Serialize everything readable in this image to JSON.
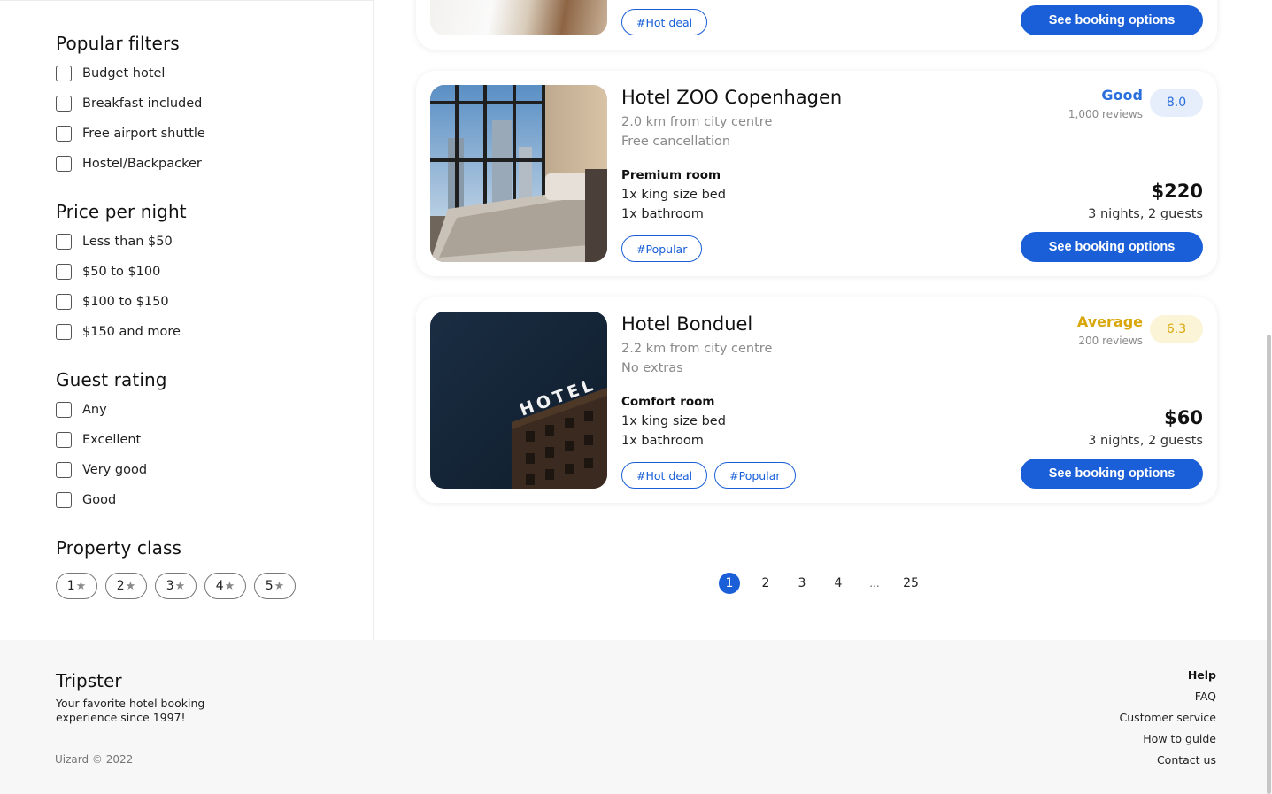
{
  "sidebar": {
    "popular_filters": {
      "title": "Popular filters",
      "options": [
        "Budget hotel",
        "Breakfast included",
        "Free airport shuttle",
        "Hostel/Backpacker"
      ]
    },
    "price": {
      "title": "Price per night",
      "options": [
        "Less than $50",
        "$50 to $100",
        "$100 to $150",
        "$150 and more"
      ]
    },
    "guest_rating": {
      "title": "Guest rating",
      "options": [
        "Any",
        "Excellent",
        "Very good",
        "Good"
      ]
    },
    "property_class": {
      "title": "Property class",
      "options": [
        "1",
        "2",
        "3",
        "4",
        "5"
      ],
      "star_glyph": "★"
    }
  },
  "top_card": {
    "tag": "#Hot deal",
    "button": "See booking options"
  },
  "hotels": [
    {
      "name": "Hotel ZOO Copenhagen",
      "distance": "2.0 km from city centre",
      "extras": "Free cancellation",
      "room_type": "Premium room",
      "bed": "1x king size bed",
      "bath": "1x bathroom",
      "tags": [
        "#Popular"
      ],
      "rating_word": "Good",
      "reviews": "1,000 reviews",
      "score": "8.0",
      "rating_color": "#2a6fdb",
      "badge_bg": "#e6eefc",
      "price": "$220",
      "price_note": "3 nights, 2 guests",
      "button": "See booking options",
      "image_icon": "bedroom-photo"
    },
    {
      "name": "Hotel Bonduel",
      "distance": "2.2 km from city centre",
      "extras": "No extras",
      "room_type": "Comfort room",
      "bed": "1x king size bed",
      "bath": "1x bathroom",
      "tags": [
        "#Hot deal",
        "#Popular"
      ],
      "rating_word": "Average",
      "reviews": "200 reviews",
      "score": "6.3",
      "rating_color": "#d9a70c",
      "badge_bg": "#fcf4d6",
      "price": "$60",
      "price_note": "3 nights, 2 guests",
      "button": "See booking options",
      "image_icon": "hotel-sign-photo",
      "image_sign": "HOTEL"
    }
  ],
  "pagination": {
    "pages": [
      "1",
      "2",
      "3",
      "4",
      "...",
      "25"
    ],
    "active": "1"
  },
  "footer": {
    "brand": "Tripster",
    "tagline": "Your favorite hotel booking experience since 1997!",
    "copyright": "Uizard © 2022",
    "links_heading": "Help",
    "links": [
      "FAQ",
      "Customer service",
      "How to guide",
      "Contact us"
    ]
  },
  "colors": {
    "accent": "#1a5fd8"
  }
}
